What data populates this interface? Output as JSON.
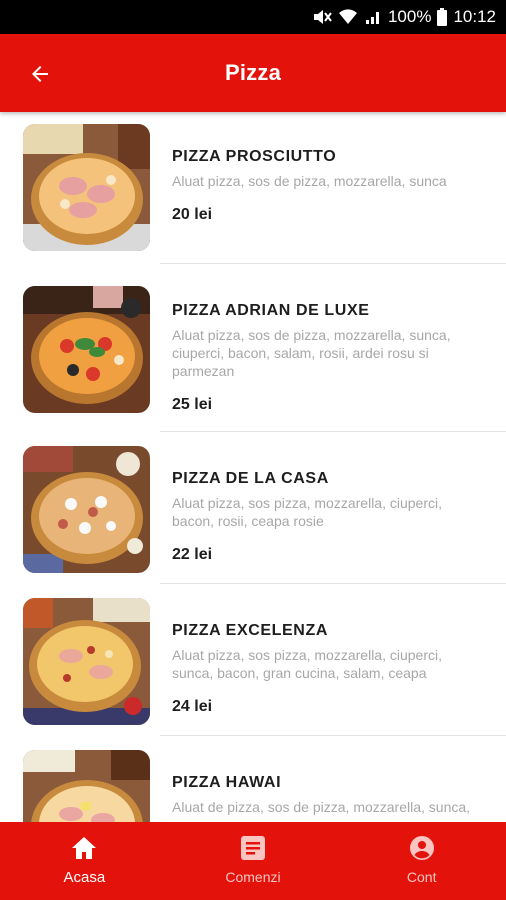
{
  "status_bar": {
    "battery": "100%",
    "time": "10:12"
  },
  "header": {
    "title": "Pizza"
  },
  "items": [
    {
      "name": "PIZZA PROSCIUTTO",
      "description": "Aluat pizza, sos de pizza, mozzarella, sunca",
      "price": "20 lei"
    },
    {
      "name": "PIZZA ADRIAN DE LUXE",
      "description": "Aluat pizza, sos de pizza, mozzarella, sunca, ciuperci, bacon, salam, rosii, ardei rosu si parmezan",
      "price": "25 lei"
    },
    {
      "name": "PIZZA DE LA CASA",
      "description": "Aluat pizza, sos pizza, mozzarella, ciuperci, bacon, rosii, ceapa rosie",
      "price": "22 lei"
    },
    {
      "name": "PIZZA EXCELENZA",
      "description": "Aluat pizza, sos pizza, mozzarella, ciuperci, sunca, bacon, gran cucina, salam, ceapa",
      "price": "24 lei"
    },
    {
      "name": "PIZZA HAWAI",
      "description": "Aluat de pizza, sos de pizza, mozzarella, sunca, ananas",
      "price": ""
    }
  ],
  "bottom_nav": [
    {
      "label": "Acasa",
      "icon": "home-icon",
      "active": true
    },
    {
      "label": "Comenzi",
      "icon": "orders-icon",
      "active": false
    },
    {
      "label": "Cont",
      "icon": "account-icon",
      "active": false
    }
  ],
  "colors": {
    "primary": "#e3120b",
    "nav_inactive": "#fbc5c2",
    "text": "#1e1e1e",
    "muted": "#a7a7a7"
  }
}
